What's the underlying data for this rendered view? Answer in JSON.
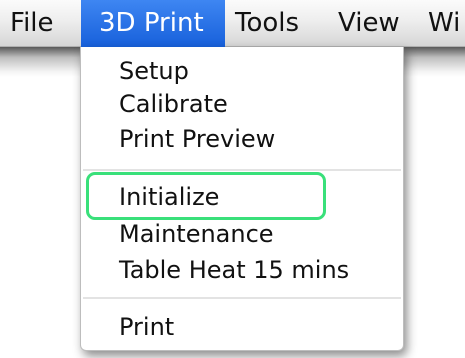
{
  "menubar": {
    "items": [
      {
        "label": "File"
      },
      {
        "label": "3D Print",
        "active": true
      },
      {
        "label": "Tools"
      },
      {
        "label": "View"
      },
      {
        "label": "Wi"
      }
    ]
  },
  "dropdown": {
    "groups": [
      {
        "items": [
          {
            "label": "Setup"
          },
          {
            "label": "Calibrate"
          },
          {
            "label": "Print Preview"
          }
        ]
      },
      {
        "items": [
          {
            "label": "Initialize",
            "highlighted": true
          },
          {
            "label": "Maintenance"
          },
          {
            "label": "Table Heat 15 mins"
          }
        ]
      },
      {
        "items": [
          {
            "label": "Print"
          }
        ]
      }
    ]
  },
  "colors": {
    "active_menu": "#2a72e6",
    "highlight_outline": "#39e07a"
  }
}
